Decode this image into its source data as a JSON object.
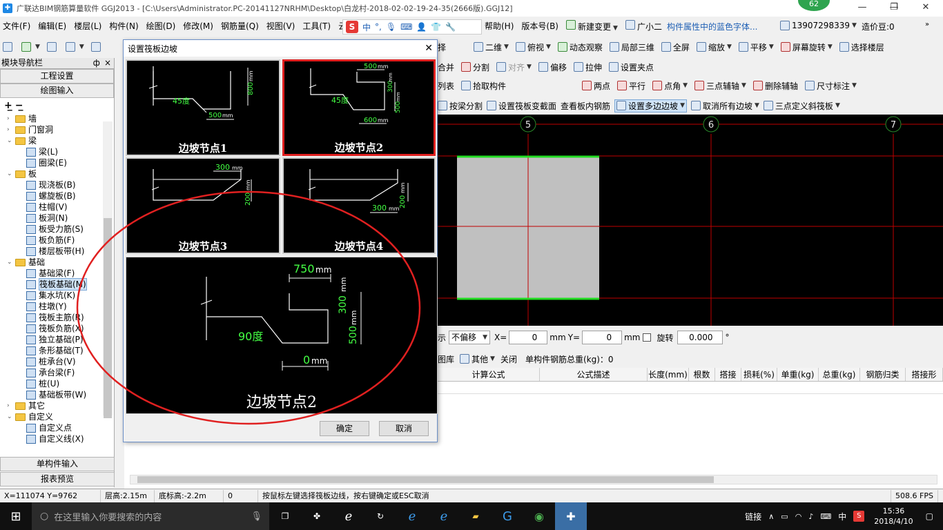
{
  "window": {
    "title": "广联达BIM钢筋算量软件 GGJ2013 - [C:\\Users\\Administrator.PC-20141127NRHM\\Desktop\\白龙村-2018-02-02-19-24-35(2666版).GGJ12]",
    "badge": "62",
    "minimize": "—",
    "maximize": "❐",
    "close": "✕"
  },
  "menu": {
    "items": [
      "文件(F)",
      "编辑(E)",
      "楼层(L)",
      "构件(N)",
      "绘图(D)",
      "修改(M)",
      "钢筋量(Q)",
      "视图(V)",
      "工具(T)",
      "云应用"
    ],
    "items_right": [
      "帮助(H)",
      "版本号(B)",
      "新建变更",
      "广小二"
    ],
    "hint": "构件属性中的蓝色字体...",
    "phone": "13907298339",
    "price": "造价豆:0",
    "ime_s": "S",
    "ime_text": "中"
  },
  "toolbar1": {
    "items": [
      "二维",
      "俯视",
      "动态观察",
      "局部三维",
      "全屏",
      "缩放",
      "平移",
      "屏幕旋转",
      "选择楼层"
    ],
    "partial": "择"
  },
  "toolbar2": {
    "items": [
      "合并",
      "分割",
      "对齐",
      "偏移",
      "拉伸",
      "设置夹点"
    ]
  },
  "toolbar3": {
    "items": [
      "列表",
      "拾取构件",
      "两点",
      "平行",
      "点角",
      "三点辅轴",
      "删除辅轴",
      "尺寸标注"
    ]
  },
  "toolbar4": {
    "items": [
      "按梁分割",
      "设置筏板变截面",
      "查看板内钢筋",
      "设置多边边坡",
      "取消所有边坡",
      "三点定义斜筏板"
    ]
  },
  "left_panel": {
    "header": "模块导航栏",
    "pin": "ф",
    "close": "×",
    "btn_top1": "工程设置",
    "btn_top2": "绘图输入",
    "btn_bottom1": "单构件输入",
    "btn_bottom2": "报表预览",
    "tree": [
      {
        "t": "f",
        "exp": ">",
        "label": "墙",
        "lv": 0
      },
      {
        "t": "f",
        "exp": ">",
        "label": "门窗洞",
        "lv": 0
      },
      {
        "t": "f",
        "exp": "v",
        "label": "梁",
        "lv": 0
      },
      {
        "t": "l",
        "label": "梁(L)",
        "lv": 1
      },
      {
        "t": "l",
        "label": "圈梁(E)",
        "lv": 1
      },
      {
        "t": "f",
        "exp": "v",
        "label": "板",
        "lv": 0
      },
      {
        "t": "l",
        "label": "现浇板(B)",
        "lv": 1
      },
      {
        "t": "l",
        "label": "螺旋板(B)",
        "lv": 1
      },
      {
        "t": "l",
        "label": "柱帽(V)",
        "lv": 1
      },
      {
        "t": "l",
        "label": "板洞(N)",
        "lv": 1
      },
      {
        "t": "l",
        "label": "板受力筋(S)",
        "lv": 1
      },
      {
        "t": "l",
        "label": "板负筋(F)",
        "lv": 1
      },
      {
        "t": "l",
        "label": "楼层板带(H)",
        "lv": 1
      },
      {
        "t": "f",
        "exp": "v",
        "label": "基础",
        "lv": 0
      },
      {
        "t": "l",
        "label": "基础梁(F)",
        "lv": 1
      },
      {
        "t": "l",
        "label": "筏板基础(M)",
        "lv": 1,
        "sel": true
      },
      {
        "t": "l",
        "label": "集水坑(K)",
        "lv": 1
      },
      {
        "t": "l",
        "label": "柱墩(Y)",
        "lv": 1
      },
      {
        "t": "l",
        "label": "筏板主筋(R)",
        "lv": 1
      },
      {
        "t": "l",
        "label": "筏板负筋(X)",
        "lv": 1
      },
      {
        "t": "l",
        "label": "独立基础(P)",
        "lv": 1
      },
      {
        "t": "l",
        "label": "条形基础(T)",
        "lv": 1
      },
      {
        "t": "l",
        "label": "桩承台(V)",
        "lv": 1
      },
      {
        "t": "l",
        "label": "承台梁(F)",
        "lv": 1
      },
      {
        "t": "l",
        "label": "桩(U)",
        "lv": 1
      },
      {
        "t": "l",
        "label": "基础板带(W)",
        "lv": 1
      },
      {
        "t": "f",
        "exp": ">",
        "label": "其它",
        "lv": 0
      },
      {
        "t": "f",
        "exp": "v",
        "label": "自定义",
        "lv": 0
      },
      {
        "t": "l",
        "label": "自定义点",
        "lv": 1
      },
      {
        "t": "l",
        "label": "自定义线(X)",
        "lv": 1
      }
    ]
  },
  "canvas": {
    "axes": [
      "5",
      "6",
      "7"
    ]
  },
  "coord_bar": {
    "prefix": "示",
    "offset": "不偏移",
    "x_label": "X=",
    "x_value": "0",
    "y_label": "Y=",
    "y_value": "0",
    "unit": "mm",
    "rotate_label": "旋转",
    "rotate_value": "0.000",
    "degree": "°"
  },
  "table_bar": {
    "items": [
      "图库",
      "其他",
      "关闭"
    ],
    "total": "单构件钢筋总重(kg)：0"
  },
  "table_columns": [
    "计算公式",
    "公式描述",
    "长度(mm)",
    "根数",
    "搭接",
    "损耗(%)",
    "单重(kg)",
    "总重(kg)",
    "钢筋归类",
    "搭接形"
  ],
  "dialog": {
    "title": "设置筏板边坡",
    "close": "✕",
    "ok": "确定",
    "cancel": "取消",
    "panels": [
      {
        "label": "边坡节点1",
        "angle": "45度",
        "d1": "500",
        "d1u": "mm",
        "d2": "800",
        "d2u": "mm"
      },
      {
        "label": "边坡节点2",
        "angle": "45度",
        "d1": "500",
        "d1u": "mm",
        "d2": "300",
        "d2u": "mm",
        "d3": "500",
        "d3u": "mm",
        "d4": "600",
        "d4u": "mm"
      },
      {
        "label": "边坡节点3",
        "d1": "300",
        "d1u": "mm",
        "d2": "200",
        "d2u": "mm"
      },
      {
        "label": "边坡节点4",
        "d1": "300",
        "d1u": "mm",
        "d2": "200",
        "d2u": "mm"
      }
    ],
    "preview": {
      "label": "边坡节点2",
      "angle": "90度",
      "top": "750",
      "top_u": "mm",
      "right": "300",
      "right_u": "mm",
      "right2": "500",
      "right2_u": "mm",
      "bottom": "0",
      "bottom_u": "mm"
    }
  },
  "status_bar": {
    "coords": "X=111074 Y=9762",
    "floor_h": "层高:2.15m",
    "base_h": "底标高:-2.2m",
    "zero": "0",
    "tip": "按鼠标左键选择筏板边线，按右键确定或ESC取消",
    "fps": "508.6 FPS"
  },
  "taskbar": {
    "search": "在这里输入你要搜索的内容",
    "link": "链接",
    "lang": "中",
    "time": "15:36",
    "date": "2018/4/10"
  },
  "colors": {
    "accent": "#1e88e5",
    "highlight_red": "#e02020",
    "slab_green": "#22dd22",
    "dim_green": "#44ff44"
  }
}
